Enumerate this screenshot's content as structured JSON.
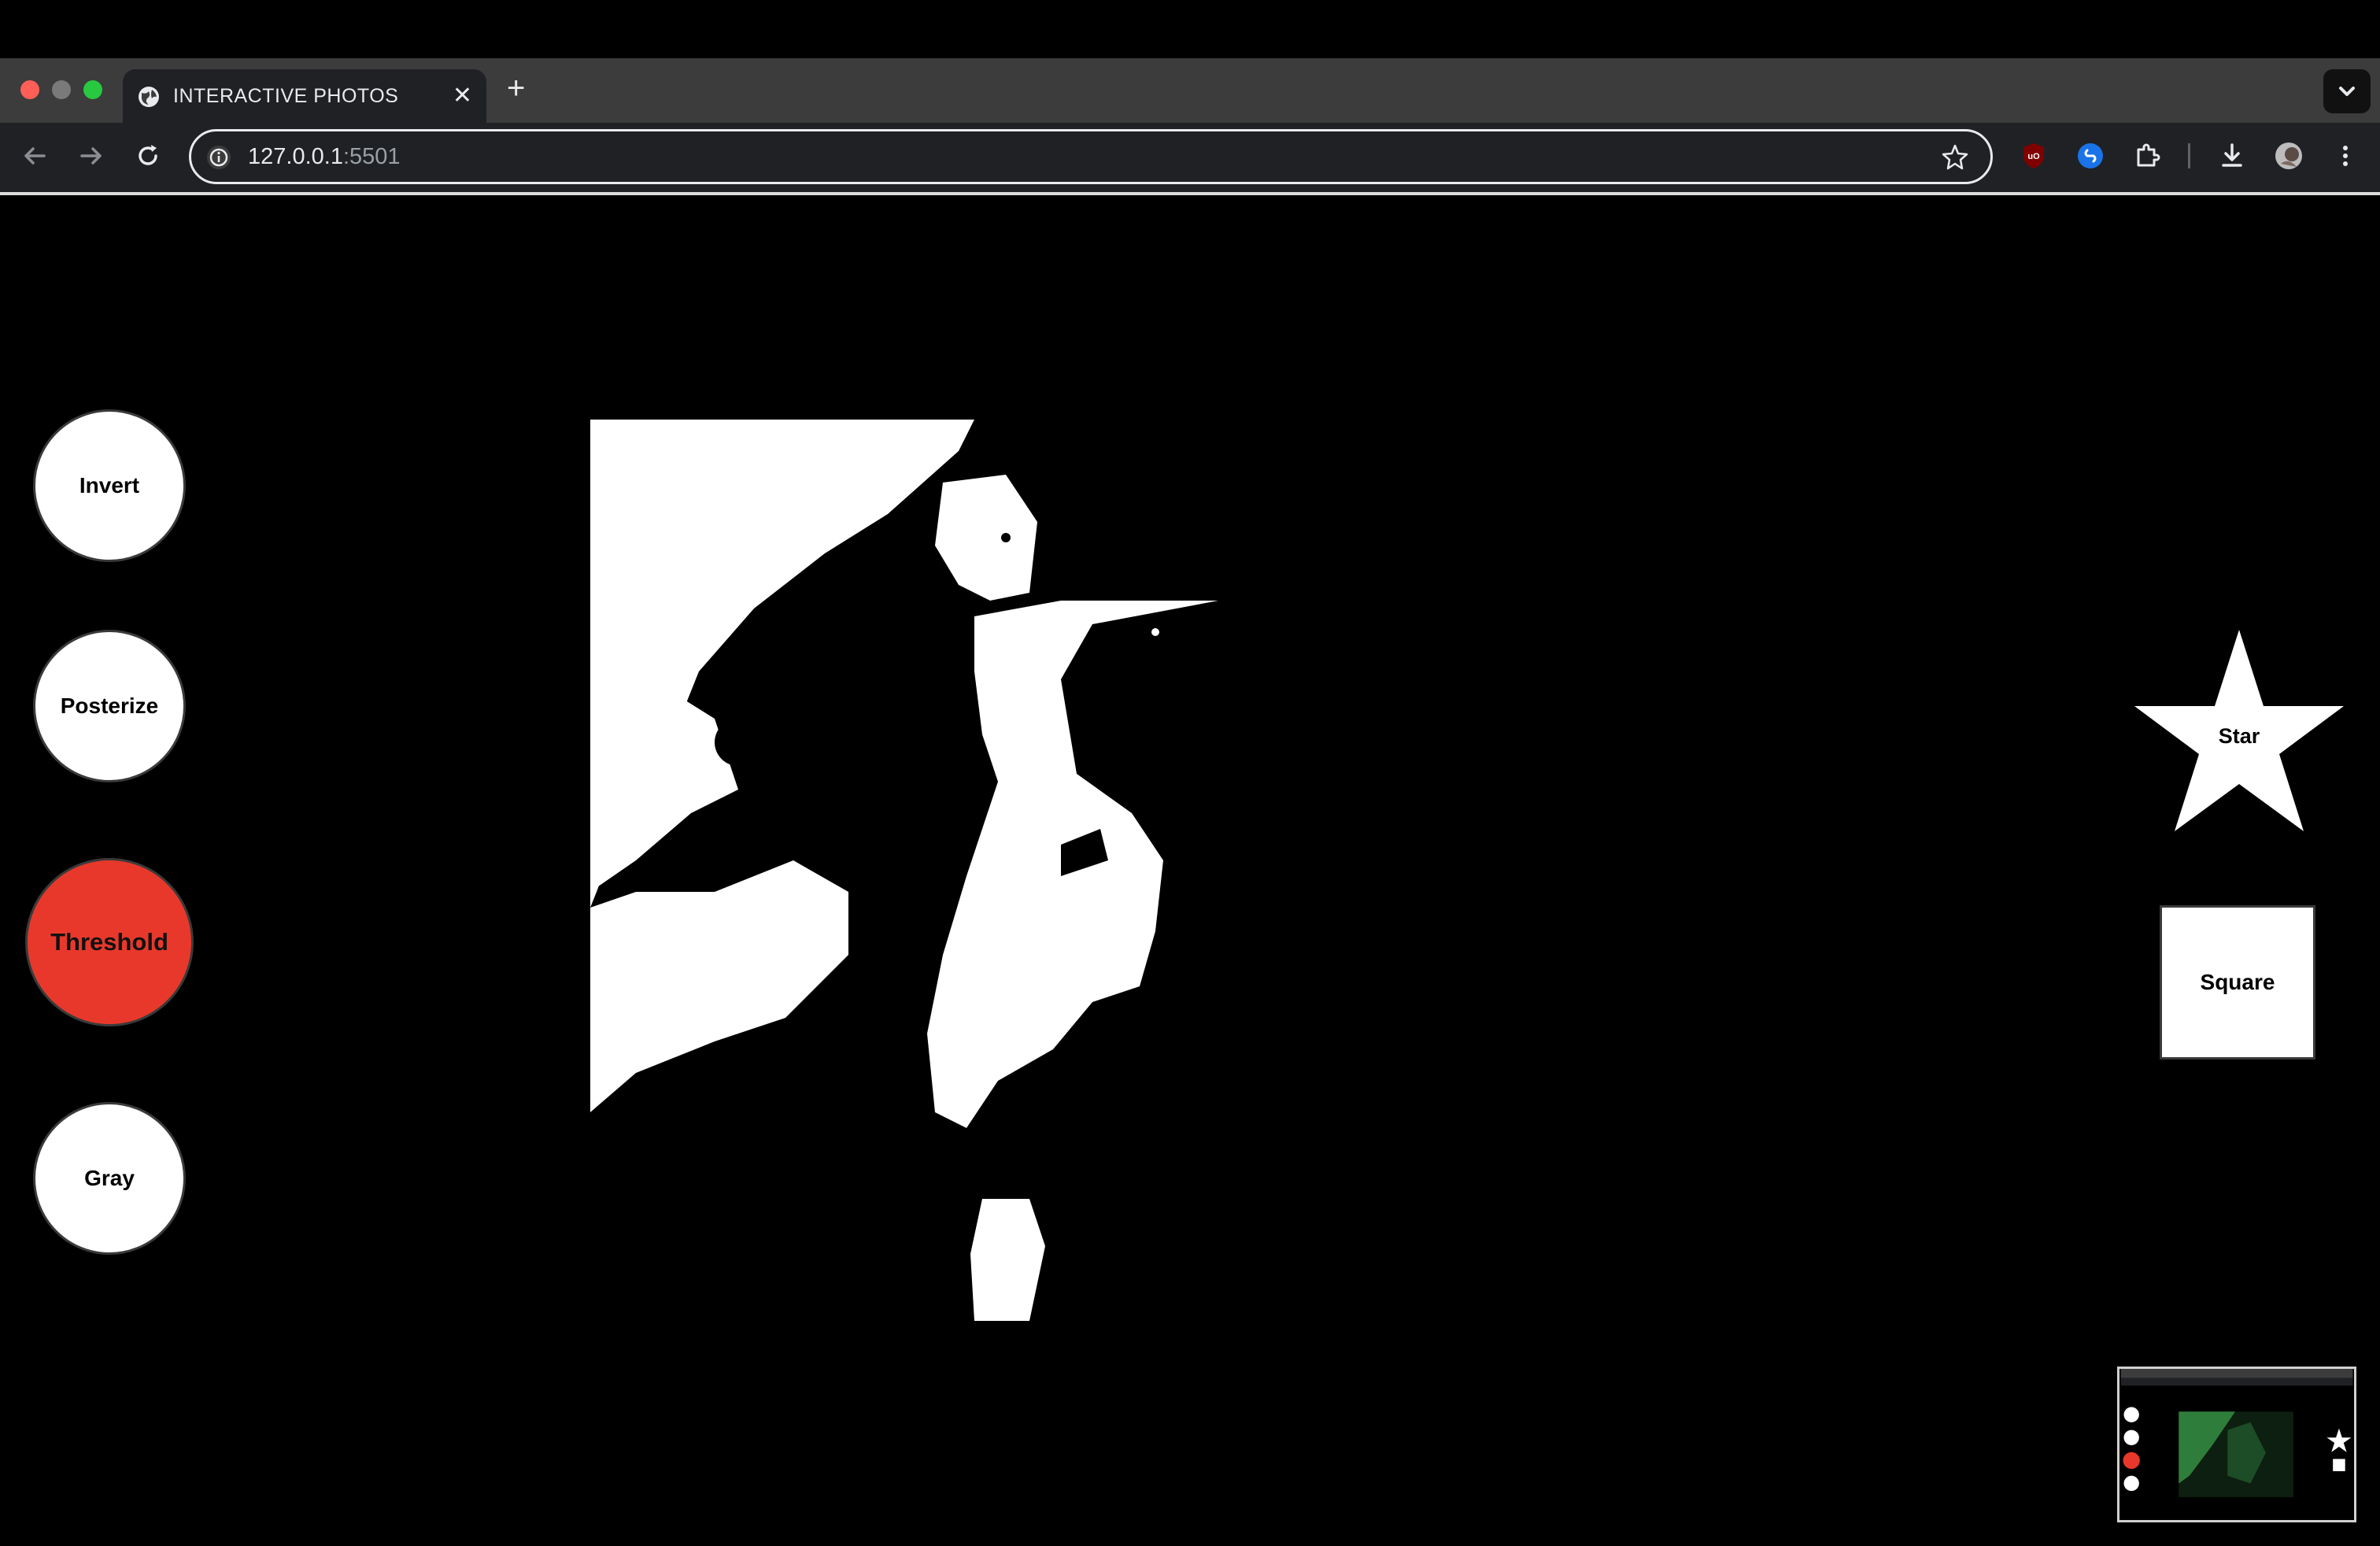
{
  "browser": {
    "tab_title": "INTERACTIVE PHOTOS",
    "url_host": "127.0.0.1",
    "url_port": ":5501",
    "colors": {
      "tabstrip": "#3c3c3c",
      "toolbar": "#202124",
      "close_red": "#ff5f57",
      "max_green": "#28c840"
    }
  },
  "filters": [
    {
      "label": "Invert",
      "active": false
    },
    {
      "label": "Posterize",
      "active": false
    },
    {
      "label": "Threshold",
      "active": true
    },
    {
      "label": "Gray",
      "active": false
    }
  ],
  "shapes": {
    "star_label": "Star",
    "square_label": "Square"
  },
  "accent_color": "#e8382b",
  "icons": [
    "back-arrow-icon",
    "forward-arrow-icon",
    "reload-icon",
    "site-info-icon",
    "bookmark-star-icon",
    "ublock-icon",
    "shazam-icon",
    "extensions-icon",
    "download-icon",
    "profile-avatar",
    "more-menu-icon"
  ]
}
